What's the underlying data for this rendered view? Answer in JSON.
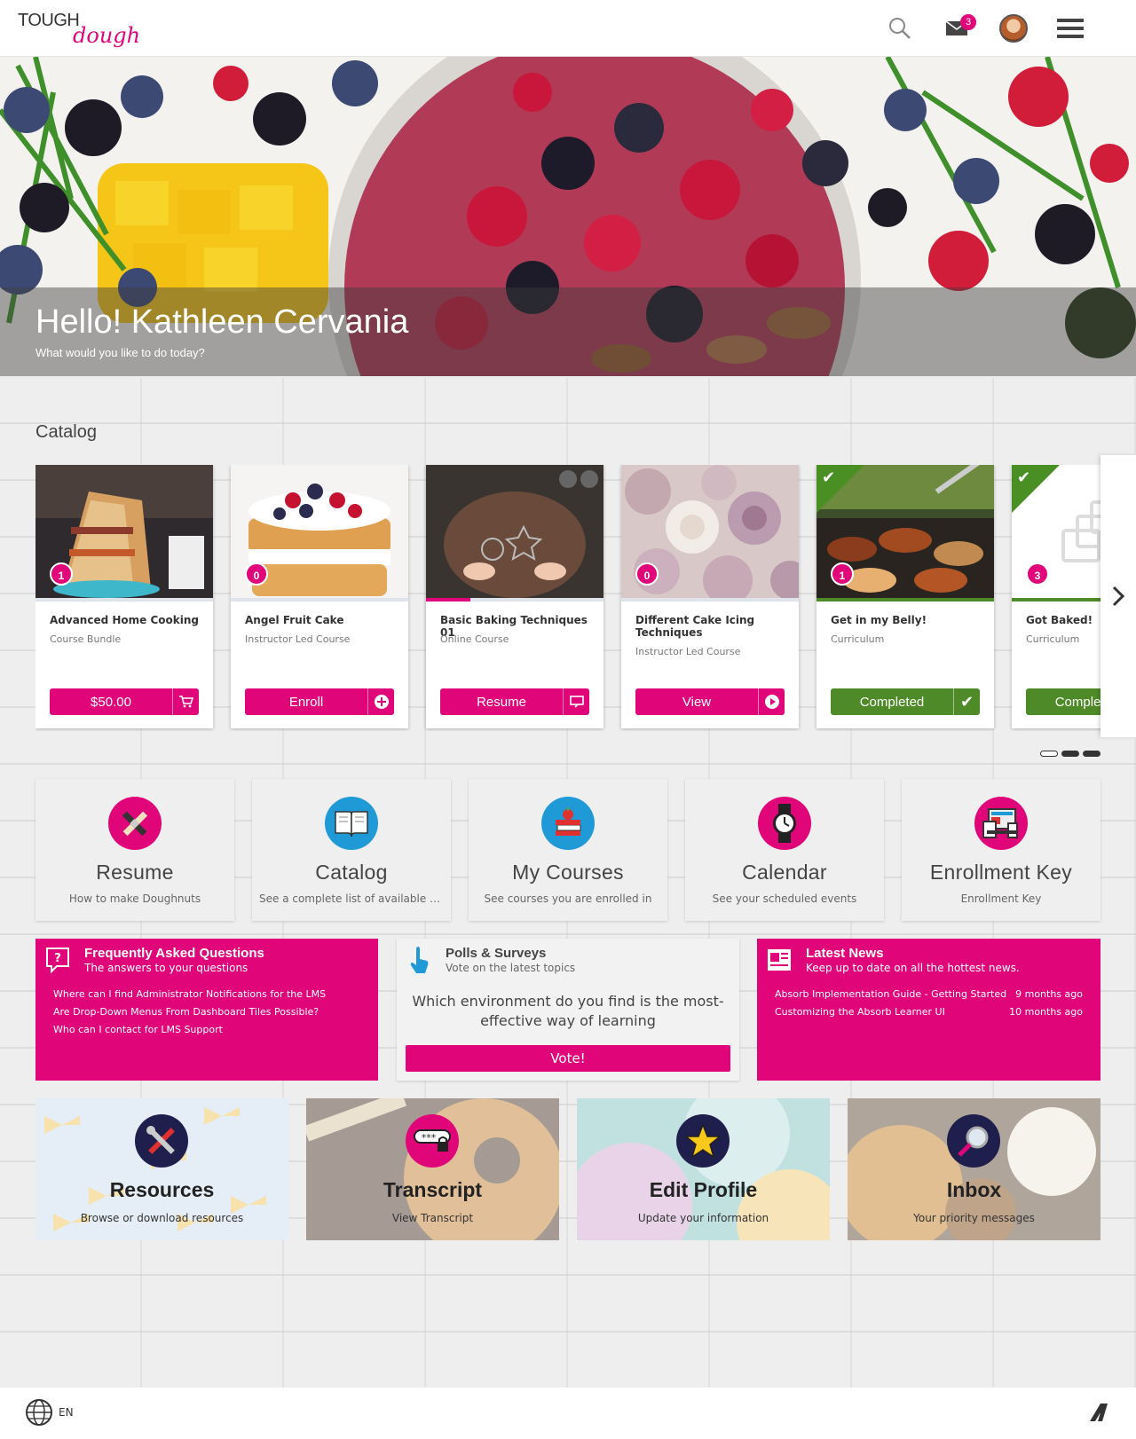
{
  "brand": {
    "logo_top": "TOUGH",
    "logo_bottom": "dough",
    "accent": "#e0067a",
    "success": "#4e8a27"
  },
  "header": {
    "icons": [
      "search-icon",
      "mail-icon",
      "avatar",
      "menu-icon"
    ],
    "mail_count": "3"
  },
  "hero": {
    "title": "Hello! Kathleen Cervania",
    "subtitle": "What would you like to do today?"
  },
  "catalog": {
    "title": "Catalog",
    "cards": [
      {
        "title": "Advanced Home Cooking",
        "type": "Course Bundle",
        "count": "1",
        "button": "$50.00",
        "button_icon": "cart-icon",
        "completed": false,
        "progress": 0
      },
      {
        "title": "Angel Fruit Cake",
        "type": "Instructor Led Course",
        "count": "0",
        "button": "Enroll",
        "button_icon": "plus-circle-icon",
        "completed": false,
        "progress": 0
      },
      {
        "title": "Basic Baking Techniques 01",
        "type": "Online Course",
        "count": "",
        "button": "Resume",
        "button_icon": "resume-icon",
        "completed": false,
        "progress": 0.25
      },
      {
        "title": "Different Cake Icing Techniques",
        "type": "Instructor Led Course",
        "count": "0",
        "button": "View",
        "button_icon": "play-circle-icon",
        "completed": false,
        "progress": 0
      },
      {
        "title": "Get in my Belly!",
        "type": "Curriculum",
        "count": "1",
        "button": "Completed",
        "button_icon": "check-icon",
        "completed": true,
        "progress": 1
      },
      {
        "title": "Got Baked!",
        "type": "Curriculum",
        "count": "3",
        "button": "Completed",
        "button_icon": "check-icon",
        "completed": true,
        "progress": 1
      }
    ],
    "page_count": 3,
    "active_page": 0
  },
  "tiles": [
    {
      "title": "Resume",
      "subtitle": "How to make Doughnuts",
      "icon": "pencil-ruler-icon"
    },
    {
      "title": "Catalog",
      "subtitle": "See a complete list of available co...",
      "icon": "book-icon"
    },
    {
      "title": "My Courses",
      "subtitle": "See courses you are enrolled in",
      "icon": "books-apple-icon"
    },
    {
      "title": "Calendar",
      "subtitle": "See your scheduled events",
      "icon": "watch-icon"
    },
    {
      "title": "Enrollment Key",
      "subtitle": "Enrollment Key",
      "icon": "devices-icon"
    }
  ],
  "faq": {
    "title": "Frequently Asked Questions",
    "subtitle": "The answers to your questions",
    "links": [
      "Where can I find Administrator Notifications for the LMS",
      "Are Drop-Down Menus From Dashboard Tiles Possible?",
      "Who can I contact for LMS Support"
    ]
  },
  "poll": {
    "title": "Polls & Surveys",
    "subtitle": "Vote on the latest topics",
    "question": "Which environment do you find is the most-effective way of learning",
    "button": "Vote!"
  },
  "news": {
    "title": "Latest News",
    "subtitle": "Keep up to date on all the hottest news.",
    "items": [
      {
        "title": "Absorb Implementation Guide - Getting Started",
        "time": "9 months ago"
      },
      {
        "title": "Customizing the Absorb Learner UI",
        "time": "10 months ago"
      }
    ]
  },
  "image_tiles": [
    {
      "title": "Resources",
      "subtitle": "Browse or download resources",
      "icon": "tools-icon"
    },
    {
      "title": "Transcript",
      "subtitle": "View Transcript",
      "icon": "password-lock-icon"
    },
    {
      "title": "Edit Profile",
      "subtitle": "Update your information",
      "icon": "star-icon"
    },
    {
      "title": "Inbox",
      "subtitle": "Your priority messages",
      "icon": "magnifier-icon"
    }
  ],
  "footer": {
    "language": "EN"
  }
}
